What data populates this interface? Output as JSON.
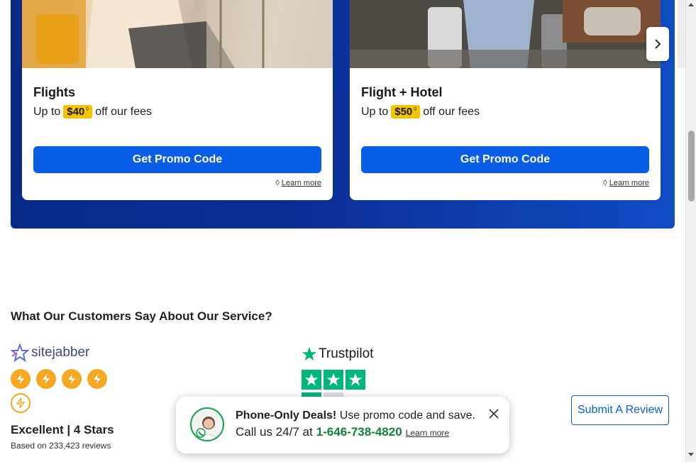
{
  "promo_cards": [
    {
      "title": "Flights",
      "sub_prefix": "Up to",
      "amount": "$40",
      "amount_mark": "◊",
      "sub_suffix": "off our fees",
      "button": "Get Promo Code",
      "learn_mark": "◊",
      "learn": "Learn more"
    },
    {
      "title": "Flight + Hotel",
      "sub_prefix": "Up to",
      "amount": "$50",
      "amount_mark": "◊",
      "sub_suffix": "off our fees",
      "button": "Get Promo Code",
      "learn_mark": "◊",
      "learn": "Learn more"
    }
  ],
  "reviews": {
    "title": "What Our Customers Say About Our Service?",
    "sitejabber": {
      "logo_text": "sitejabber",
      "filled_stars": 4,
      "rating": "Excellent | 4 Stars",
      "based_on": "Based on 233,423 reviews"
    },
    "trustpilot": {
      "logo_text": "Trustpilot"
    },
    "submit_button": "Submit A Review"
  },
  "toast": {
    "bold": "Phone-Only Deals!",
    "text": "Use promo code and save.",
    "call_prefix": "Call us 24/7 at",
    "phone": "1-646-738-4820",
    "learn": "Learn more"
  },
  "colors": {
    "brand_blue": "#0a5ee6",
    "badge_yellow": "#f5c400",
    "trustpilot_green": "#00b67a",
    "sitejabber_orange": "#f7a823",
    "phone_green": "#15803d"
  },
  "icons": [
    "chevron-right-icon",
    "close-icon",
    "lightning-icon",
    "star-icon",
    "sitejabber-logo-icon"
  ]
}
